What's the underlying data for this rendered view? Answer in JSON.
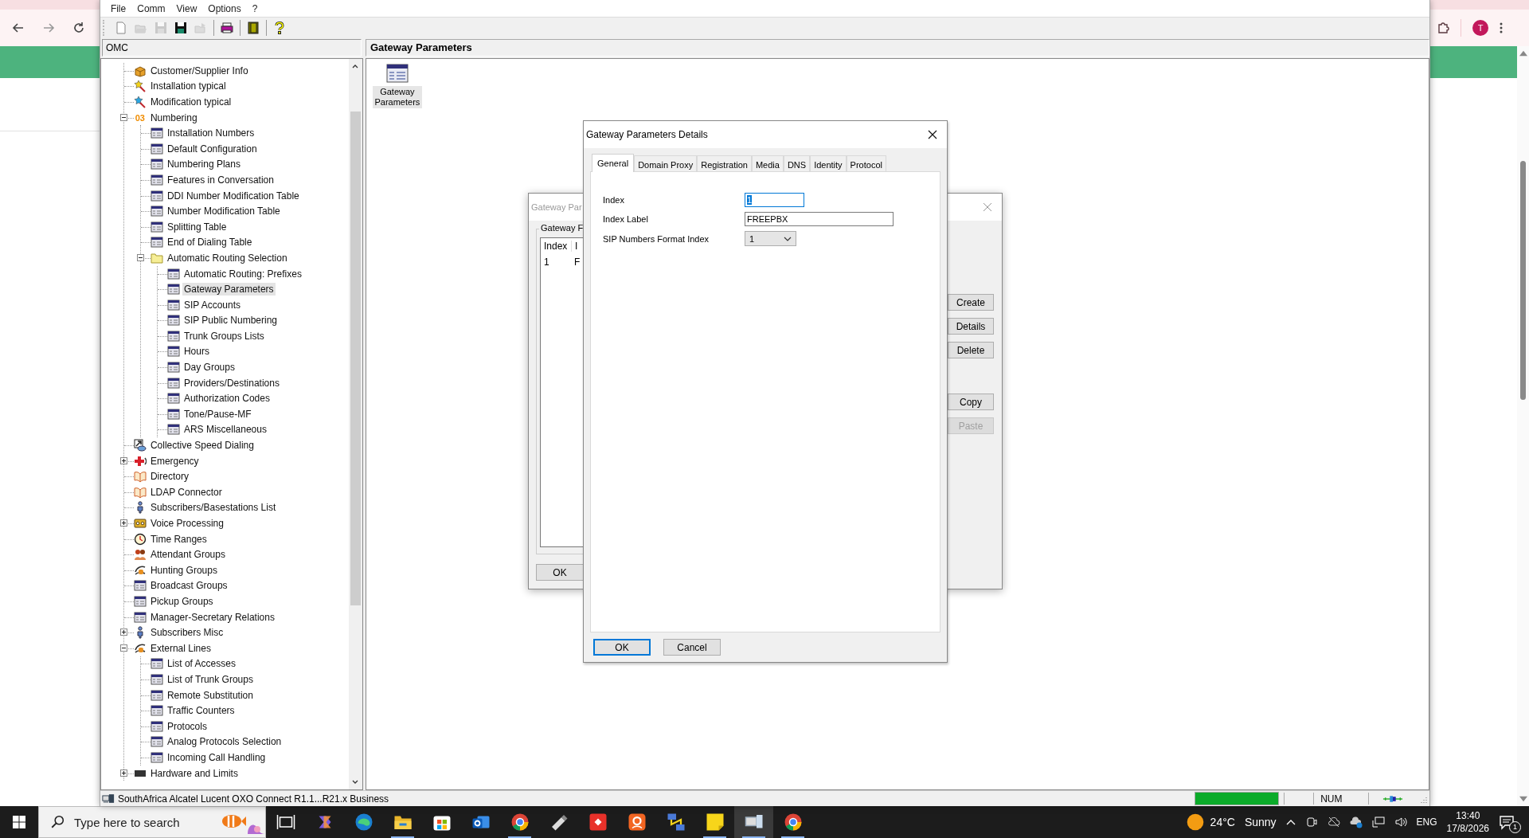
{
  "browser": {
    "avatar_letter": "T"
  },
  "app": {
    "menu": [
      "File",
      "Comm",
      "View",
      "Options",
      "?"
    ],
    "toolbar": [
      {
        "kind": "new",
        "disabled": false
      },
      {
        "kind": "open",
        "disabled": true
      },
      {
        "kind": "save",
        "disabled": true
      },
      {
        "kind": "save",
        "disabled": false
      },
      {
        "kind": "send",
        "disabled": true
      },
      {
        "kind": "print",
        "disabled": false
      },
      {
        "kind": "exit",
        "disabled": false
      },
      {
        "kind": "help",
        "disabled": false
      }
    ],
    "tree_header": "OMC",
    "tree": [
      {
        "label": "Customer/Supplier Info",
        "kind": "box",
        "selected": false
      },
      {
        "label": "Installation typical",
        "kind": "wand",
        "selected": false
      },
      {
        "label": "Modification typical",
        "kind": "wand2",
        "selected": false
      },
      {
        "label": "Numbering",
        "kind": "digits",
        "badge": "03",
        "selected": false,
        "expanded": true,
        "children": [
          {
            "label": "Installation Numbers",
            "kind": "table",
            "selected": false
          },
          {
            "label": "Default Configuration",
            "kind": "table",
            "selected": false
          },
          {
            "label": "Numbering Plans",
            "kind": "table",
            "selected": false
          },
          {
            "label": "Features in Conversation",
            "kind": "table",
            "selected": false
          },
          {
            "label": "DDI Number Modification Table",
            "kind": "table",
            "selected": false
          },
          {
            "label": "Number Modification Table",
            "kind": "table",
            "selected": false
          },
          {
            "label": "Splitting Table",
            "kind": "table",
            "selected": false
          },
          {
            "label": "End of Dialing Table",
            "kind": "table",
            "selected": false
          },
          {
            "label": "Automatic Routing Selection",
            "kind": "folder",
            "selected": false,
            "expanded": true,
            "children": [
              {
                "label": "Automatic Routing: Prefixes",
                "kind": "table",
                "selected": false
              },
              {
                "label": "Gateway Parameters",
                "kind": "table",
                "selected": true
              },
              {
                "label": "SIP Accounts",
                "kind": "table",
                "selected": false
              },
              {
                "label": "SIP Public Numbering",
                "kind": "table",
                "selected": false
              },
              {
                "label": "Trunk Groups Lists",
                "kind": "table",
                "selected": false
              },
              {
                "label": "Hours",
                "kind": "table",
                "selected": false
              },
              {
                "label": "Day Groups",
                "kind": "table",
                "selected": false
              },
              {
                "label": "Providers/Destinations",
                "kind": "table",
                "selected": false
              },
              {
                "label": "Authorization Codes",
                "kind": "table",
                "selected": false
              },
              {
                "label": "Tone/Pause-MF",
                "kind": "table",
                "selected": false
              },
              {
                "label": "ARS Miscellaneous",
                "kind": "table",
                "selected": false
              }
            ]
          }
        ]
      },
      {
        "label": "Collective Speed Dialing",
        "kind": "dial",
        "selected": false
      },
      {
        "label": "Emergency",
        "kind": "cross",
        "selected": false,
        "expanded": false
      },
      {
        "label": "Directory",
        "kind": "book",
        "selected": false
      },
      {
        "label": "LDAP Connector",
        "kind": "book",
        "selected": false
      },
      {
        "label": "Subscribers/Basestations List",
        "kind": "person",
        "selected": false
      },
      {
        "label": "Voice Processing",
        "kind": "tape",
        "selected": false,
        "expanded": false
      },
      {
        "label": "Time Ranges",
        "kind": "clock",
        "selected": false
      },
      {
        "label": "Attendant Groups",
        "kind": "people",
        "selected": false
      },
      {
        "label": "Hunting Groups",
        "kind": "hand",
        "selected": false
      },
      {
        "label": "Broadcast Groups",
        "kind": "table",
        "selected": false
      },
      {
        "label": "Pickup Groups",
        "kind": "table",
        "selected": false
      },
      {
        "label": "Manager-Secretary Relations",
        "kind": "table",
        "selected": false
      },
      {
        "label": "Subscribers Misc",
        "kind": "person",
        "selected": false,
        "expanded": false
      },
      {
        "label": "External Lines",
        "kind": "hand",
        "selected": false,
        "expanded": true,
        "children": [
          {
            "label": "List of Accesses",
            "kind": "table",
            "selected": false
          },
          {
            "label": "List of Trunk Groups",
            "kind": "table",
            "selected": false
          },
          {
            "label": "Remote Substitution",
            "kind": "table",
            "selected": false
          },
          {
            "label": "Traffic Counters",
            "kind": "table",
            "selected": false
          },
          {
            "label": "Protocols",
            "kind": "table",
            "selected": false
          },
          {
            "label": "Analog Protocols Selection",
            "kind": "table",
            "selected": false
          },
          {
            "label": "Incoming Call Handling",
            "kind": "table",
            "selected": false
          }
        ]
      },
      {
        "label": "Hardware and Limits",
        "kind": "device",
        "selected": false,
        "expanded": false
      }
    ],
    "content_title": "Gateway Parameters",
    "content_items": [
      {
        "label": "Gateway Parameters",
        "selected": true
      }
    ],
    "status_bar": {
      "text": "SouthAfrica Alcatel Lucent OXO Connect R1.1...R21.x Business",
      "level": 1,
      "indicator": "NUM"
    }
  },
  "list_dialog": {
    "title": "Gateway Par",
    "group_label": "Gateway F",
    "columns": [
      "Index",
      "I"
    ],
    "rows": [
      [
        "1",
        "F"
      ]
    ],
    "buttons": [
      {
        "label": "Create",
        "disabled": false
      },
      {
        "label": "Details",
        "disabled": false
      },
      {
        "label": "Delete",
        "disabled": false
      },
      {
        "label": "Copy",
        "disabled": false
      },
      {
        "label": "Paste",
        "disabled": true
      }
    ],
    "ok": "OK"
  },
  "details_dialog": {
    "title": "Gateway Parameters Details",
    "tabs": [
      {
        "label": "General",
        "selected": true
      },
      {
        "label": "Domain Proxy",
        "selected": false
      },
      {
        "label": "Registration",
        "selected": false
      },
      {
        "label": "Media",
        "selected": false
      },
      {
        "label": "DNS",
        "selected": false
      },
      {
        "label": "Identity",
        "selected": false
      },
      {
        "label": "Protocol",
        "selected": false
      }
    ],
    "fields": [
      {
        "kind": "text",
        "label": "Index",
        "value": "1",
        "focused": true
      },
      {
        "kind": "text",
        "label": "Index Label",
        "value": "FREEPBX",
        "focused": false
      },
      {
        "kind": "dropdown",
        "label": "SIP Numbers Format Index",
        "value": "1",
        "focused": false
      }
    ],
    "buttons": [
      {
        "label": "OK",
        "default": true
      },
      {
        "label": "Cancel",
        "default": false
      }
    ]
  },
  "taskbar": {
    "search_placeholder": "Type here to search",
    "apps": [
      {
        "kind": "taskview",
        "open": false,
        "active": false
      },
      {
        "kind": "copilot",
        "open": false,
        "active": false
      },
      {
        "kind": "edge",
        "open": false,
        "active": false
      },
      {
        "kind": "explorer",
        "open": true,
        "active": false
      },
      {
        "kind": "store",
        "open": false,
        "active": false
      },
      {
        "kind": "outlook",
        "open": false,
        "active": false
      },
      {
        "kind": "chrome",
        "open": true,
        "active": false
      },
      {
        "kind": "usb",
        "open": false,
        "active": false
      },
      {
        "kind": "remote",
        "open": false,
        "active": false
      },
      {
        "kind": "orange",
        "open": false,
        "active": false
      },
      {
        "kind": "network",
        "open": false,
        "active": false
      },
      {
        "kind": "notes",
        "open": true,
        "active": false
      },
      {
        "kind": "omc",
        "open": true,
        "active": true
      },
      {
        "kind": "chrome",
        "open": true,
        "active": false
      }
    ],
    "weather": {
      "temperature": "24°C",
      "condition": "Sunny"
    },
    "language": "ENG",
    "time": "13:40",
    "date": "17/8/2026",
    "notification_count": "1"
  }
}
